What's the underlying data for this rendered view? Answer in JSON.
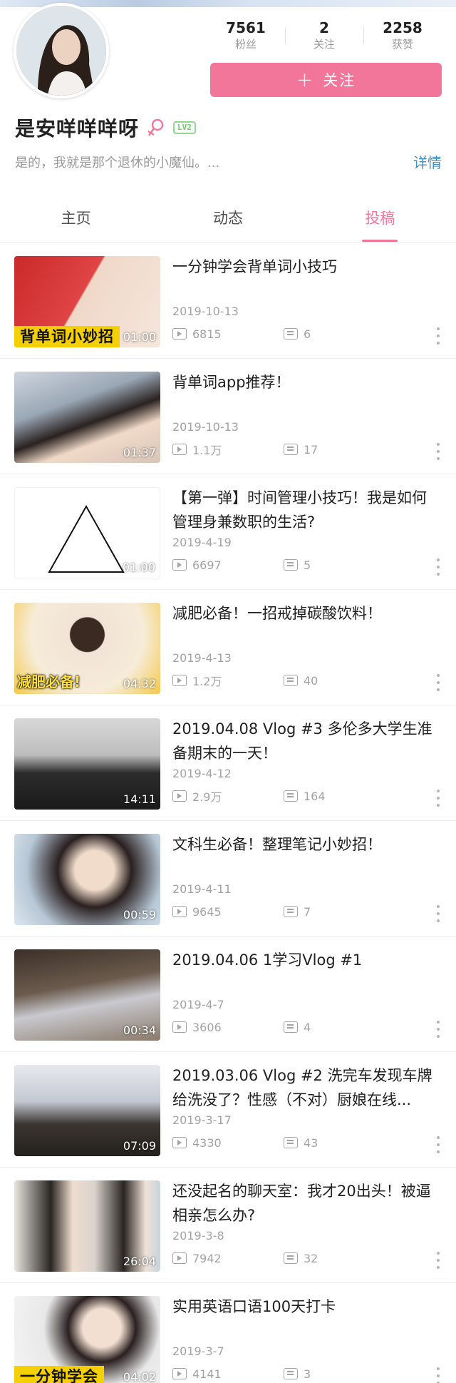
{
  "profile": {
    "name": "是安咩咩咩呀",
    "level": "LV2",
    "bio": "是的，我就是那个退休的小魔仙。...",
    "detail_label": "详情",
    "follow_label": "关注",
    "stats": [
      {
        "value": "7561",
        "label": "粉丝"
      },
      {
        "value": "2",
        "label": "关注"
      },
      {
        "value": "2258",
        "label": "获赞"
      }
    ]
  },
  "tabs": [
    {
      "label": "主页",
      "active": false
    },
    {
      "label": "动态",
      "active": false
    },
    {
      "label": "投稿",
      "active": true
    }
  ],
  "colors": {
    "accent": "#f2769a",
    "link": "#3f8fc4",
    "level_badge": "#6ccf6a"
  },
  "videos": [
    {
      "title": "一分钟学会背单词小技巧",
      "date": "2019-10-13",
      "plays": "6815",
      "danmaku": "6",
      "duration": "01:00",
      "thumb_caption": "背单词小妙招"
    },
    {
      "title": "背单词app推荐！",
      "date": "2019-10-13",
      "plays": "1.1万",
      "danmaku": "17",
      "duration": "01:37",
      "thumb_caption": ""
    },
    {
      "title": "【第一弹】时间管理小技巧！我是如何管理身兼数职的生活?",
      "date": "2019-4-19",
      "plays": "6697",
      "danmaku": "5",
      "duration": "01:00",
      "thumb_caption": ""
    },
    {
      "title": "减肥必备！一招戒掉碳酸饮料！",
      "date": "2019-4-13",
      "plays": "1.2万",
      "danmaku": "40",
      "duration": "04:32",
      "thumb_caption": "减肥必备!"
    },
    {
      "title": "2019.04.08 Vlog #3 多伦多大学生准备期末的一天！",
      "date": "2019-4-12",
      "plays": "2.9万",
      "danmaku": "164",
      "duration": "14:11",
      "thumb_caption": ""
    },
    {
      "title": "文科生必备！整理笔记小妙招！",
      "date": "2019-4-11",
      "plays": "9645",
      "danmaku": "7",
      "duration": "00:59",
      "thumb_caption": ""
    },
    {
      "title": "2019.04.06 1学习Vlog #1",
      "date": "2019-4-7",
      "plays": "3606",
      "danmaku": "4",
      "duration": "00:34",
      "thumb_caption": ""
    },
    {
      "title": "2019.03.06 Vlog #2 洗完车发现车牌给洗没了？性感（不对）厨娘在线...",
      "date": "2019-3-17",
      "plays": "4330",
      "danmaku": "43",
      "duration": "07:09",
      "thumb_caption": ""
    },
    {
      "title": "还没起名的聊天室：我才20出头！被逼相亲怎么办?",
      "date": "2019-3-8",
      "plays": "7942",
      "danmaku": "32",
      "duration": "26:04",
      "thumb_caption": ""
    },
    {
      "title": "实用英语口语100天打卡",
      "date": "2019-3-7",
      "plays": "4141",
      "danmaku": "3",
      "duration": "04:02",
      "thumb_caption": "一分钟学会"
    }
  ]
}
